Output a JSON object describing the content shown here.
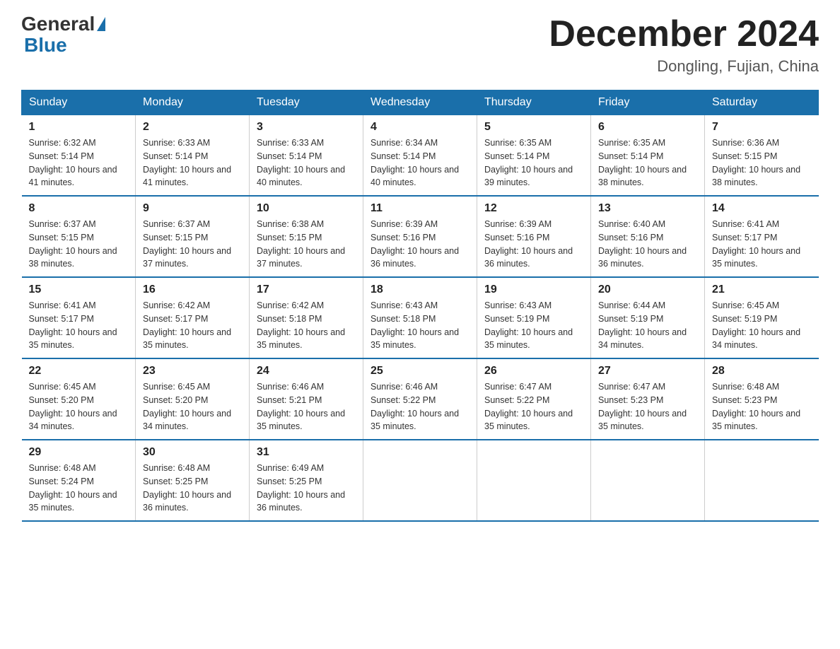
{
  "logo": {
    "general": "General",
    "blue": "Blue"
  },
  "header": {
    "title": "December 2024",
    "location": "Dongling, Fujian, China"
  },
  "weekdays": [
    "Sunday",
    "Monday",
    "Tuesday",
    "Wednesday",
    "Thursday",
    "Friday",
    "Saturday"
  ],
  "weeks": [
    [
      {
        "day": "1",
        "sunrise": "6:32 AM",
        "sunset": "5:14 PM",
        "daylight": "10 hours and 41 minutes."
      },
      {
        "day": "2",
        "sunrise": "6:33 AM",
        "sunset": "5:14 PM",
        "daylight": "10 hours and 41 minutes."
      },
      {
        "day": "3",
        "sunrise": "6:33 AM",
        "sunset": "5:14 PM",
        "daylight": "10 hours and 40 minutes."
      },
      {
        "day": "4",
        "sunrise": "6:34 AM",
        "sunset": "5:14 PM",
        "daylight": "10 hours and 40 minutes."
      },
      {
        "day": "5",
        "sunrise": "6:35 AM",
        "sunset": "5:14 PM",
        "daylight": "10 hours and 39 minutes."
      },
      {
        "day": "6",
        "sunrise": "6:35 AM",
        "sunset": "5:14 PM",
        "daylight": "10 hours and 38 minutes."
      },
      {
        "day": "7",
        "sunrise": "6:36 AM",
        "sunset": "5:15 PM",
        "daylight": "10 hours and 38 minutes."
      }
    ],
    [
      {
        "day": "8",
        "sunrise": "6:37 AM",
        "sunset": "5:15 PM",
        "daylight": "10 hours and 38 minutes."
      },
      {
        "day": "9",
        "sunrise": "6:37 AM",
        "sunset": "5:15 PM",
        "daylight": "10 hours and 37 minutes."
      },
      {
        "day": "10",
        "sunrise": "6:38 AM",
        "sunset": "5:15 PM",
        "daylight": "10 hours and 37 minutes."
      },
      {
        "day": "11",
        "sunrise": "6:39 AM",
        "sunset": "5:16 PM",
        "daylight": "10 hours and 36 minutes."
      },
      {
        "day": "12",
        "sunrise": "6:39 AM",
        "sunset": "5:16 PM",
        "daylight": "10 hours and 36 minutes."
      },
      {
        "day": "13",
        "sunrise": "6:40 AM",
        "sunset": "5:16 PM",
        "daylight": "10 hours and 36 minutes."
      },
      {
        "day": "14",
        "sunrise": "6:41 AM",
        "sunset": "5:17 PM",
        "daylight": "10 hours and 35 minutes."
      }
    ],
    [
      {
        "day": "15",
        "sunrise": "6:41 AM",
        "sunset": "5:17 PM",
        "daylight": "10 hours and 35 minutes."
      },
      {
        "day": "16",
        "sunrise": "6:42 AM",
        "sunset": "5:17 PM",
        "daylight": "10 hours and 35 minutes."
      },
      {
        "day": "17",
        "sunrise": "6:42 AM",
        "sunset": "5:18 PM",
        "daylight": "10 hours and 35 minutes."
      },
      {
        "day": "18",
        "sunrise": "6:43 AM",
        "sunset": "5:18 PM",
        "daylight": "10 hours and 35 minutes."
      },
      {
        "day": "19",
        "sunrise": "6:43 AM",
        "sunset": "5:19 PM",
        "daylight": "10 hours and 35 minutes."
      },
      {
        "day": "20",
        "sunrise": "6:44 AM",
        "sunset": "5:19 PM",
        "daylight": "10 hours and 34 minutes."
      },
      {
        "day": "21",
        "sunrise": "6:45 AM",
        "sunset": "5:19 PM",
        "daylight": "10 hours and 34 minutes."
      }
    ],
    [
      {
        "day": "22",
        "sunrise": "6:45 AM",
        "sunset": "5:20 PM",
        "daylight": "10 hours and 34 minutes."
      },
      {
        "day": "23",
        "sunrise": "6:45 AM",
        "sunset": "5:20 PM",
        "daylight": "10 hours and 34 minutes."
      },
      {
        "day": "24",
        "sunrise": "6:46 AM",
        "sunset": "5:21 PM",
        "daylight": "10 hours and 35 minutes."
      },
      {
        "day": "25",
        "sunrise": "6:46 AM",
        "sunset": "5:22 PM",
        "daylight": "10 hours and 35 minutes."
      },
      {
        "day": "26",
        "sunrise": "6:47 AM",
        "sunset": "5:22 PM",
        "daylight": "10 hours and 35 minutes."
      },
      {
        "day": "27",
        "sunrise": "6:47 AM",
        "sunset": "5:23 PM",
        "daylight": "10 hours and 35 minutes."
      },
      {
        "day": "28",
        "sunrise": "6:48 AM",
        "sunset": "5:23 PM",
        "daylight": "10 hours and 35 minutes."
      }
    ],
    [
      {
        "day": "29",
        "sunrise": "6:48 AM",
        "sunset": "5:24 PM",
        "daylight": "10 hours and 35 minutes."
      },
      {
        "day": "30",
        "sunrise": "6:48 AM",
        "sunset": "5:25 PM",
        "daylight": "10 hours and 36 minutes."
      },
      {
        "day": "31",
        "sunrise": "6:49 AM",
        "sunset": "5:25 PM",
        "daylight": "10 hours and 36 minutes."
      },
      null,
      null,
      null,
      null
    ]
  ],
  "colors": {
    "header_bg": "#1a6faa",
    "border": "#1a6faa"
  }
}
